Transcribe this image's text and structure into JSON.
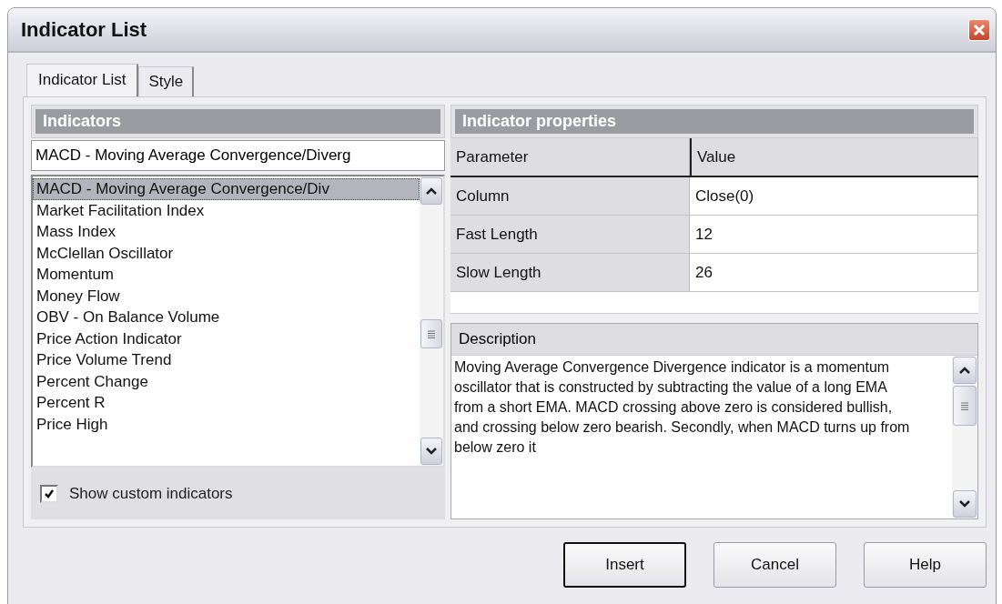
{
  "window": {
    "title": "Indicator List"
  },
  "tabs": [
    {
      "label": "Indicator List",
      "selected": true
    },
    {
      "label": "Style",
      "selected": false
    }
  ],
  "indicators": {
    "header": "Indicators",
    "selected_name": "MACD - Moving Average Convergence/Diverg",
    "items": [
      {
        "label": "MACD - Moving Average Convergence/Div",
        "selected": true
      },
      {
        "label": "Market Facilitation Index",
        "selected": false
      },
      {
        "label": "Mass Index",
        "selected": false
      },
      {
        "label": "McClellan Oscillator",
        "selected": false
      },
      {
        "label": "Momentum",
        "selected": false
      },
      {
        "label": "Money Flow",
        "selected": false
      },
      {
        "label": "OBV - On Balance Volume",
        "selected": false
      },
      {
        "label": "Price Action Indicator",
        "selected": false
      },
      {
        "label": "Price Volume Trend",
        "selected": false
      },
      {
        "label": "Percent Change",
        "selected": false
      },
      {
        "label": "Percent R",
        "selected": false
      },
      {
        "label": "Price High",
        "selected": false
      }
    ],
    "show_custom": {
      "label": "Show custom indicators",
      "checked": true
    }
  },
  "properties": {
    "header": "Indicator properties",
    "columns": [
      "Parameter",
      "Value"
    ],
    "rows": [
      [
        "Column",
        "Close(0)"
      ],
      [
        "Fast Length",
        "12"
      ],
      [
        "Slow Length",
        "26"
      ]
    ]
  },
  "description": {
    "header": "Description",
    "text": "Moving Average Convergence Divergence indicator is a momentum oscillator that is constructed by subtracting the value of a long EMA from a short EMA. MACD crossing above zero is considered bullish, and crossing below zero bearish. Secondly, when MACD turns up from below zero it"
  },
  "buttons": [
    {
      "label": "Insert",
      "default": true
    },
    {
      "label": "Cancel",
      "default": false
    },
    {
      "label": "Help",
      "default": false
    }
  ]
}
